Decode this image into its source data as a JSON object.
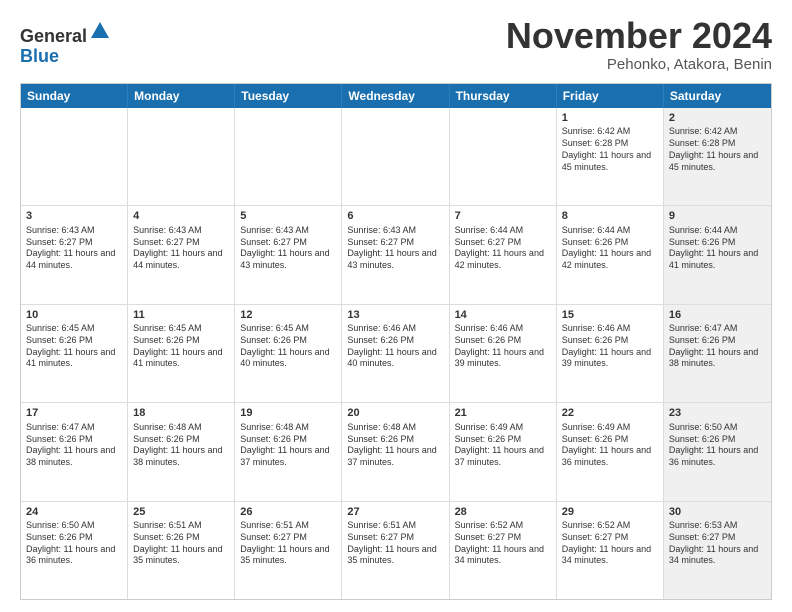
{
  "logo": {
    "general": "General",
    "blue": "Blue"
  },
  "title": "November 2024",
  "location": "Pehonko, Atakora, Benin",
  "header_days": [
    "Sunday",
    "Monday",
    "Tuesday",
    "Wednesday",
    "Thursday",
    "Friday",
    "Saturday"
  ],
  "weeks": [
    [
      {
        "day": "",
        "info": "",
        "shaded": false
      },
      {
        "day": "",
        "info": "",
        "shaded": false
      },
      {
        "day": "",
        "info": "",
        "shaded": false
      },
      {
        "day": "",
        "info": "",
        "shaded": false
      },
      {
        "day": "",
        "info": "",
        "shaded": false
      },
      {
        "day": "1",
        "info": "Sunrise: 6:42 AM\nSunset: 6:28 PM\nDaylight: 11 hours and 45 minutes.",
        "shaded": false
      },
      {
        "day": "2",
        "info": "Sunrise: 6:42 AM\nSunset: 6:28 PM\nDaylight: 11 hours and 45 minutes.",
        "shaded": true
      }
    ],
    [
      {
        "day": "3",
        "info": "Sunrise: 6:43 AM\nSunset: 6:27 PM\nDaylight: 11 hours and 44 minutes.",
        "shaded": false
      },
      {
        "day": "4",
        "info": "Sunrise: 6:43 AM\nSunset: 6:27 PM\nDaylight: 11 hours and 44 minutes.",
        "shaded": false
      },
      {
        "day": "5",
        "info": "Sunrise: 6:43 AM\nSunset: 6:27 PM\nDaylight: 11 hours and 43 minutes.",
        "shaded": false
      },
      {
        "day": "6",
        "info": "Sunrise: 6:43 AM\nSunset: 6:27 PM\nDaylight: 11 hours and 43 minutes.",
        "shaded": false
      },
      {
        "day": "7",
        "info": "Sunrise: 6:44 AM\nSunset: 6:27 PM\nDaylight: 11 hours and 42 minutes.",
        "shaded": false
      },
      {
        "day": "8",
        "info": "Sunrise: 6:44 AM\nSunset: 6:26 PM\nDaylight: 11 hours and 42 minutes.",
        "shaded": false
      },
      {
        "day": "9",
        "info": "Sunrise: 6:44 AM\nSunset: 6:26 PM\nDaylight: 11 hours and 41 minutes.",
        "shaded": true
      }
    ],
    [
      {
        "day": "10",
        "info": "Sunrise: 6:45 AM\nSunset: 6:26 PM\nDaylight: 11 hours and 41 minutes.",
        "shaded": false
      },
      {
        "day": "11",
        "info": "Sunrise: 6:45 AM\nSunset: 6:26 PM\nDaylight: 11 hours and 41 minutes.",
        "shaded": false
      },
      {
        "day": "12",
        "info": "Sunrise: 6:45 AM\nSunset: 6:26 PM\nDaylight: 11 hours and 40 minutes.",
        "shaded": false
      },
      {
        "day": "13",
        "info": "Sunrise: 6:46 AM\nSunset: 6:26 PM\nDaylight: 11 hours and 40 minutes.",
        "shaded": false
      },
      {
        "day": "14",
        "info": "Sunrise: 6:46 AM\nSunset: 6:26 PM\nDaylight: 11 hours and 39 minutes.",
        "shaded": false
      },
      {
        "day": "15",
        "info": "Sunrise: 6:46 AM\nSunset: 6:26 PM\nDaylight: 11 hours and 39 minutes.",
        "shaded": false
      },
      {
        "day": "16",
        "info": "Sunrise: 6:47 AM\nSunset: 6:26 PM\nDaylight: 11 hours and 38 minutes.",
        "shaded": true
      }
    ],
    [
      {
        "day": "17",
        "info": "Sunrise: 6:47 AM\nSunset: 6:26 PM\nDaylight: 11 hours and 38 minutes.",
        "shaded": false
      },
      {
        "day": "18",
        "info": "Sunrise: 6:48 AM\nSunset: 6:26 PM\nDaylight: 11 hours and 38 minutes.",
        "shaded": false
      },
      {
        "day": "19",
        "info": "Sunrise: 6:48 AM\nSunset: 6:26 PM\nDaylight: 11 hours and 37 minutes.",
        "shaded": false
      },
      {
        "day": "20",
        "info": "Sunrise: 6:48 AM\nSunset: 6:26 PM\nDaylight: 11 hours and 37 minutes.",
        "shaded": false
      },
      {
        "day": "21",
        "info": "Sunrise: 6:49 AM\nSunset: 6:26 PM\nDaylight: 11 hours and 37 minutes.",
        "shaded": false
      },
      {
        "day": "22",
        "info": "Sunrise: 6:49 AM\nSunset: 6:26 PM\nDaylight: 11 hours and 36 minutes.",
        "shaded": false
      },
      {
        "day": "23",
        "info": "Sunrise: 6:50 AM\nSunset: 6:26 PM\nDaylight: 11 hours and 36 minutes.",
        "shaded": true
      }
    ],
    [
      {
        "day": "24",
        "info": "Sunrise: 6:50 AM\nSunset: 6:26 PM\nDaylight: 11 hours and 36 minutes.",
        "shaded": false
      },
      {
        "day": "25",
        "info": "Sunrise: 6:51 AM\nSunset: 6:26 PM\nDaylight: 11 hours and 35 minutes.",
        "shaded": false
      },
      {
        "day": "26",
        "info": "Sunrise: 6:51 AM\nSunset: 6:27 PM\nDaylight: 11 hours and 35 minutes.",
        "shaded": false
      },
      {
        "day": "27",
        "info": "Sunrise: 6:51 AM\nSunset: 6:27 PM\nDaylight: 11 hours and 35 minutes.",
        "shaded": false
      },
      {
        "day": "28",
        "info": "Sunrise: 6:52 AM\nSunset: 6:27 PM\nDaylight: 11 hours and 34 minutes.",
        "shaded": false
      },
      {
        "day": "29",
        "info": "Sunrise: 6:52 AM\nSunset: 6:27 PM\nDaylight: 11 hours and 34 minutes.",
        "shaded": false
      },
      {
        "day": "30",
        "info": "Sunrise: 6:53 AM\nSunset: 6:27 PM\nDaylight: 11 hours and 34 minutes.",
        "shaded": true
      }
    ]
  ]
}
